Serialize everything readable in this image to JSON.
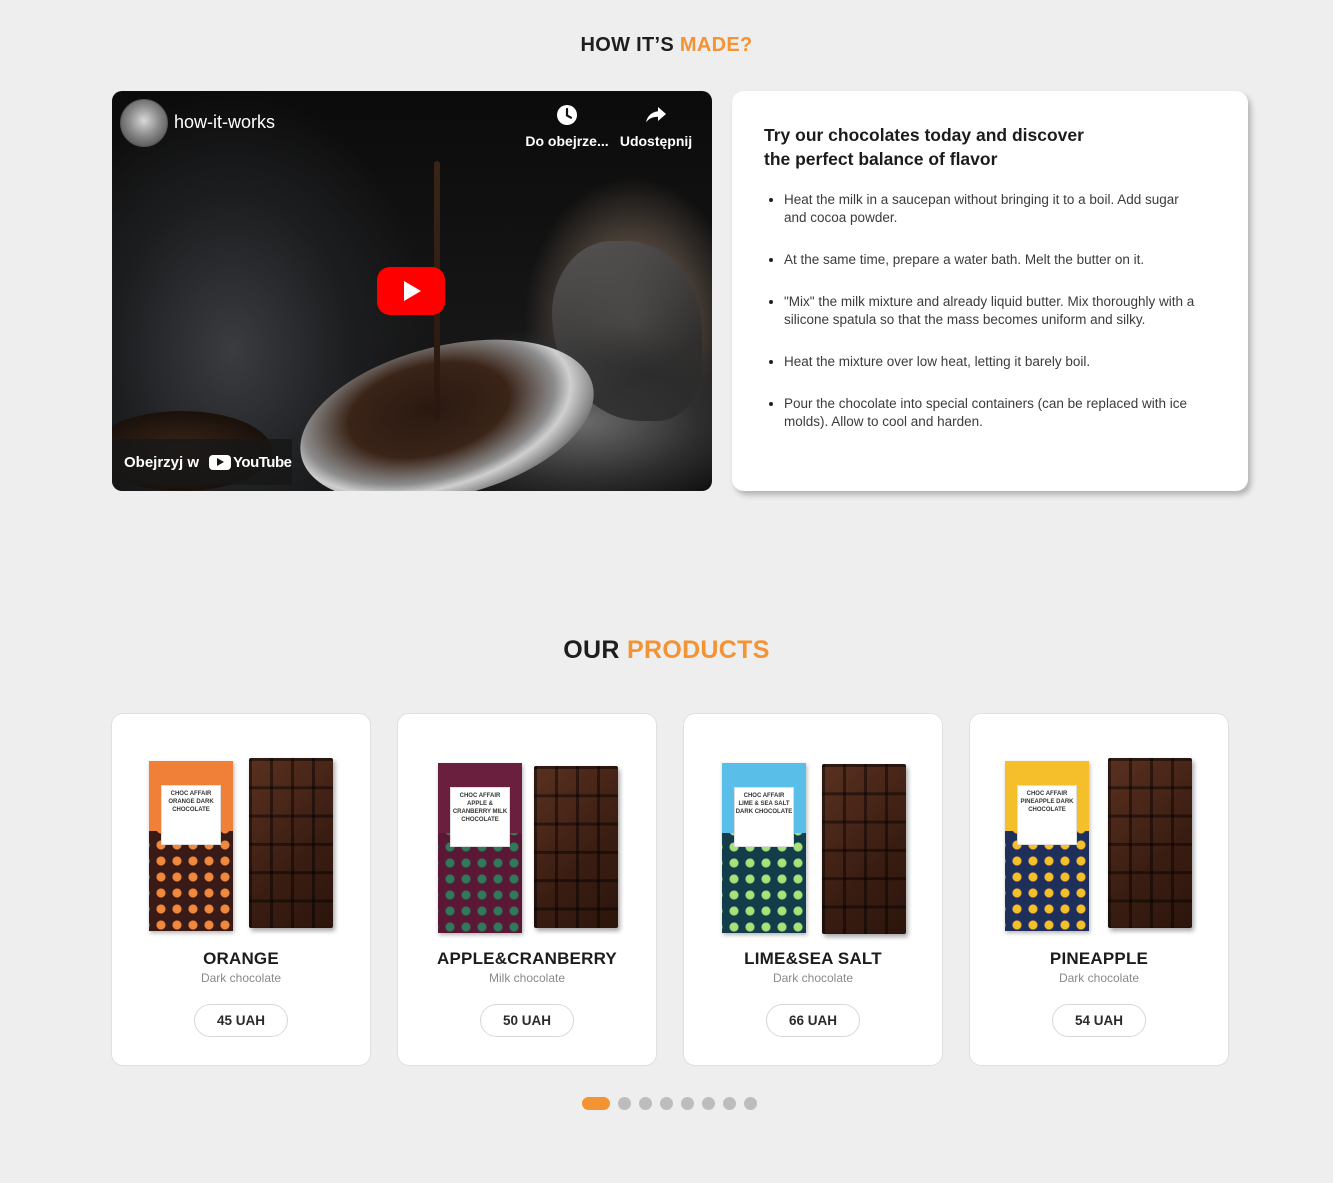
{
  "how_section": {
    "title_part1": "HOW IT’S ",
    "title_accent": "MADE?"
  },
  "video": {
    "channel_title": "how-it-works",
    "watch_later_label": "Do obejrze...",
    "share_label": "Udostępnij",
    "watch_on_label": "Obejrzyj w",
    "youtube_label": "YouTube"
  },
  "info": {
    "heading": "Try our chocolates today and discover the perfect balance of flavor",
    "steps": [
      "Heat the milk in a saucepan without bringing it to a boil. Add sugar and cocoa powder.",
      "At the same time, prepare a water bath. Melt the butter on it.",
      "\"Mix\" the milk mixture and already liquid butter. Mix thoroughly with a silicone spatula so that the mass becomes uniform and silky.",
      "Heat the mixture over low heat, letting it barely boil.",
      "Pour the chocolate into special containers (can be replaced with ice molds). Allow to cool and harden."
    ]
  },
  "products_section": {
    "title_part1": "OUR ",
    "title_accent": "PRODUCTS"
  },
  "products": [
    {
      "name": "ORANGE",
      "type": "Dark chocolate",
      "price": "45 UAH",
      "wrapper_label": "ORANGE DARK CHOCOLATE",
      "brand": "CHOC AFFAIR",
      "top_color": "#f07f37",
      "pattern_color": "#3a1a16",
      "accent_color": "#ef8a3c"
    },
    {
      "name": "APPLE&CRANBERRY",
      "type": "Milk chocolate",
      "price": "50 UAH",
      "wrapper_label": "APPLE & CRANBERRY MILK CHOCOLATE",
      "brand": "CHOC AFFAIR",
      "top_color": "#6a1f3f",
      "pattern_color": "#5a1836",
      "accent_color": "#2f7a5a"
    },
    {
      "name": "LIME&SEA SALT",
      "type": "Dark chocolate",
      "price": "66 UAH",
      "wrapper_label": "LIME & SEA SALT DARK CHOCOLATE",
      "brand": "CHOC AFFAIR",
      "top_color": "#59bfe8",
      "pattern_color": "#133d4a",
      "accent_color": "#a8e07a"
    },
    {
      "name": "PINEAPPLE",
      "type": "Dark chocolate",
      "price": "54 UAH",
      "wrapper_label": "PINEAPPLE DARK CHOCOLATE",
      "brand": "CHOC AFFAIR",
      "top_color": "#f4bf2a",
      "pattern_color": "#1e2f5c",
      "accent_color": "#f4bf2a"
    }
  ],
  "pagination": {
    "total": 8,
    "active": 0
  },
  "colors": {
    "accent": "#f39334",
    "background": "#eeeeee"
  }
}
